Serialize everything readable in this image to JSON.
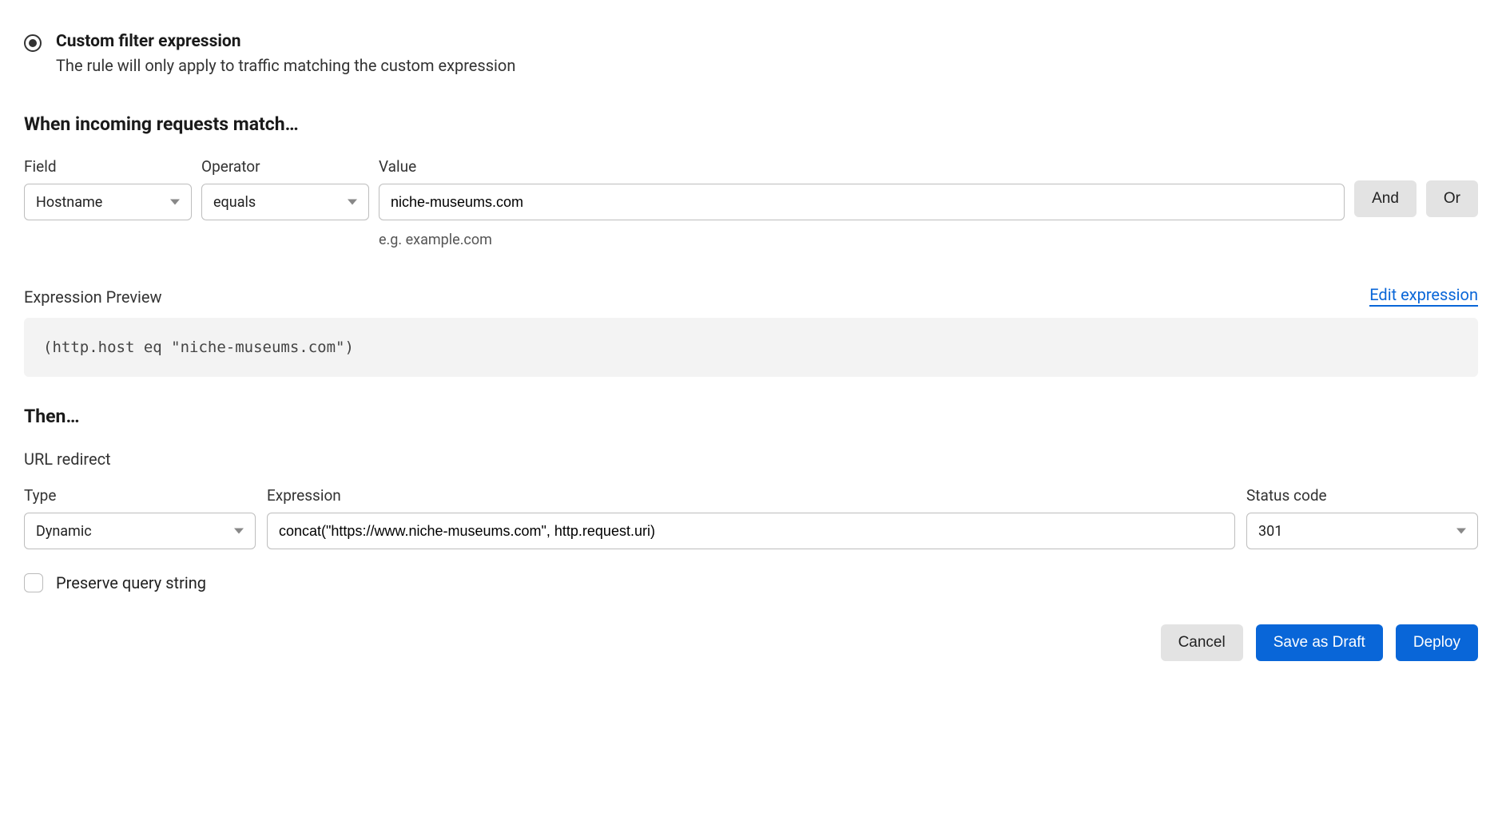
{
  "filter_option": {
    "title": "Custom filter expression",
    "description": "The rule will only apply to traffic matching the custom expression"
  },
  "match_section": {
    "heading": "When incoming requests match…",
    "field_label": "Field",
    "field_value": "Hostname",
    "operator_label": "Operator",
    "operator_value": "equals",
    "value_label": "Value",
    "value_input": "niche-museums.com",
    "value_hint": "e.g. example.com",
    "and_button": "And",
    "or_button": "Or"
  },
  "preview": {
    "label": "Expression Preview",
    "edit_link": "Edit expression",
    "code": "(http.host eq \"niche-museums.com\")"
  },
  "then_section": {
    "heading": "Then…",
    "subheading": "URL redirect",
    "type_label": "Type",
    "type_value": "Dynamic",
    "expression_label": "Expression",
    "expression_value": "concat(\"https://www.niche-museums.com\", http.request.uri)",
    "status_label": "Status code",
    "status_value": "301",
    "preserve_label": "Preserve query string"
  },
  "footer": {
    "cancel": "Cancel",
    "save_draft": "Save as Draft",
    "deploy": "Deploy"
  }
}
